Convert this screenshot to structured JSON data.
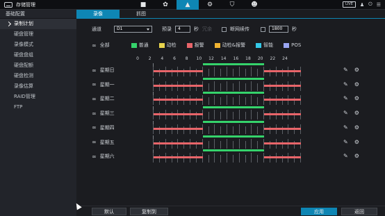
{
  "header": {
    "title": "存储管理",
    "live_label": "LIVE",
    "top_icons": [
      "camera-icon",
      "network-icon",
      "storage-icon",
      "settings-icon",
      "shield-icon",
      "account-icon"
    ],
    "right_icons": [
      "user-icon",
      "exit-icon",
      "menu-icon"
    ]
  },
  "sidebar": {
    "header": "基础配置",
    "items": [
      {
        "label": "录制计划",
        "active": true
      },
      {
        "label": "硬盘管理"
      },
      {
        "label": "录像模式"
      },
      {
        "label": "硬盘盘组"
      },
      {
        "label": "硬盘配额"
      },
      {
        "label": "硬盘检测"
      },
      {
        "label": "录像估算"
      },
      {
        "label": "RAID管理"
      },
      {
        "label": "FTP"
      }
    ]
  },
  "tabs": [
    {
      "label": "录像",
      "active": true
    },
    {
      "label": "抓图"
    }
  ],
  "controls": {
    "channel_label": "通道",
    "channel_value": "D1",
    "prerecord_label": "预录",
    "prerecord_value": "4",
    "prerecord_unit": "秒",
    "redundancy_label": "冗余",
    "anr_label": "断网续传",
    "anr_value": "1800",
    "anr_unit": "秒"
  },
  "legend": {
    "all_label": "全部",
    "items": [
      {
        "label": "普通",
        "color": "#35d36b"
      },
      {
        "label": "动检",
        "color": "#e8d44d"
      },
      {
        "label": "报警",
        "color": "#e8656a"
      },
      {
        "label": "动检&报警",
        "color": "#f0b331"
      },
      {
        "label": "智能",
        "color": "#34c9e8"
      },
      {
        "label": "POS",
        "color": "#9aa6f2"
      }
    ]
  },
  "timeline": {
    "ticks": [
      "0",
      "2",
      "4",
      "6",
      "8",
      "10",
      "12",
      "14",
      "16",
      "18",
      "20",
      "22",
      "24"
    ],
    "days": [
      {
        "label": "星期日",
        "segments": [
          {
            "start": 0,
            "end": 8,
            "type": "报警"
          },
          {
            "start": 8,
            "end": 18,
            "type": "普通"
          },
          {
            "start": 18,
            "end": 24,
            "type": "报警"
          }
        ]
      },
      {
        "label": "星期一",
        "segments": [
          {
            "start": 0,
            "end": 8,
            "type": "报警"
          },
          {
            "start": 8,
            "end": 18,
            "type": "普通"
          },
          {
            "start": 18,
            "end": 24,
            "type": "报警"
          }
        ]
      },
      {
        "label": "星期二",
        "segments": [
          {
            "start": 0,
            "end": 8,
            "type": "报警"
          },
          {
            "start": 8,
            "end": 18,
            "type": "普通"
          },
          {
            "start": 18,
            "end": 24,
            "type": "报警"
          }
        ]
      },
      {
        "label": "星期三",
        "segments": [
          {
            "start": 0,
            "end": 8,
            "type": "报警"
          },
          {
            "start": 8,
            "end": 18,
            "type": "普通"
          },
          {
            "start": 18,
            "end": 24,
            "type": "报警"
          }
        ]
      },
      {
        "label": "星期四",
        "segments": [
          {
            "start": 0,
            "end": 8,
            "type": "报警"
          },
          {
            "start": 8,
            "end": 18,
            "type": "普通"
          },
          {
            "start": 18,
            "end": 24,
            "type": "报警"
          }
        ]
      },
      {
        "label": "星期五",
        "segments": [
          {
            "start": 0,
            "end": 8,
            "type": "报警"
          },
          {
            "start": 8,
            "end": 18,
            "type": "普通"
          },
          {
            "start": 18,
            "end": 24,
            "type": "报警"
          }
        ]
      },
      {
        "label": "星期六",
        "segments": [
          {
            "start": 0,
            "end": 8,
            "type": "报警"
          },
          {
            "start": 8,
            "end": 18,
            "type": "普通"
          },
          {
            "start": 18,
            "end": 24,
            "type": "报警"
          }
        ]
      }
    ]
  },
  "footer": {
    "default_label": "默认",
    "copy_label": "复制到",
    "apply_label": "应用",
    "back_label": "返回"
  }
}
